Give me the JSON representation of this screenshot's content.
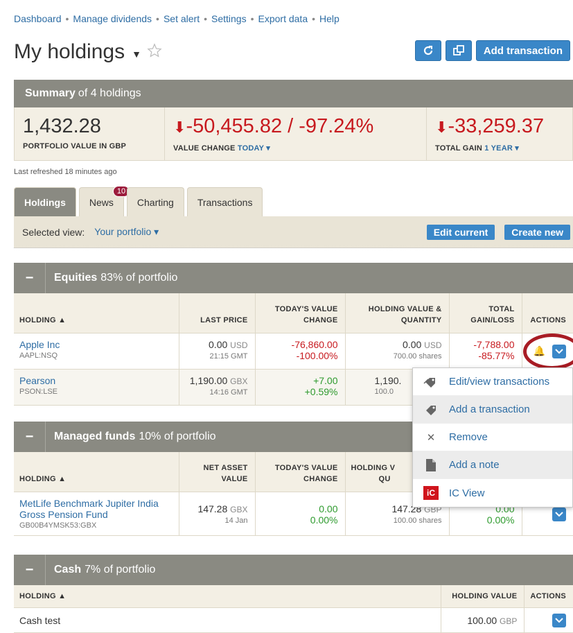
{
  "nav": [
    "Dashboard",
    "Manage dividends",
    "Set alert",
    "Settings",
    "Export data",
    "Help"
  ],
  "title": "My holdings",
  "top_buttons": {
    "add_transaction": "Add transaction"
  },
  "summary": {
    "head_bold": "Summary",
    "head_rest": "of 4 holdings",
    "portfolio_value": "1,432.28",
    "portfolio_label": "PORTFOLIO VALUE IN GBP",
    "value_change": "-50,455.82 / -97.24%",
    "value_change_label": "VALUE CHANGE",
    "value_change_period": "TODAY",
    "total_gain": "-33,259.37",
    "total_gain_label": "TOTAL GAIN",
    "total_gain_period": "1 YEAR"
  },
  "refreshed": "Last refreshed 18 minutes ago",
  "tabs": {
    "holdings": "Holdings",
    "news": "News",
    "news_badge": "10",
    "charting": "Charting",
    "transactions": "Transactions"
  },
  "viewbar": {
    "label": "Selected view:",
    "value": "Your portfolio",
    "edit": "Edit current",
    "create": "Create new"
  },
  "equities": {
    "name": "Equities",
    "pct": "83% of portfolio",
    "headers": [
      "HOLDING ▲",
      "LAST PRICE",
      "TODAY'S VALUE CHANGE",
      "HOLDING VALUE & QUANTITY",
      "TOTAL GAIN/LOSS",
      "ACTIONS"
    ],
    "rows": [
      {
        "name": "Apple Inc",
        "ticker": "AAPL:NSQ",
        "price": "0.00",
        "price_cur": "USD",
        "price_time": "21:15 GMT",
        "chg": "-76,860.00",
        "chg_pct": "-100.00%",
        "val": "0.00",
        "val_cur": "USD",
        "qty": "700.00 shares",
        "gain": "-7,788.00",
        "gain_pct": "-85.77%"
      },
      {
        "name": "Pearson",
        "ticker": "PSON:LSE",
        "price": "1,190.00",
        "price_cur": "GBX",
        "price_time": "14:16 GMT",
        "chg": "+7.00",
        "chg_pct": "+0.59%",
        "val": "1,190.",
        "qty": "100.0"
      }
    ]
  },
  "funds": {
    "name": "Managed funds",
    "pct": "10% of portfolio",
    "headers": [
      "HOLDING ▲",
      "NET ASSET VALUE",
      "TODAY'S VALUE CHANGE",
      "HOLDING V",
      "QU"
    ],
    "rows": [
      {
        "name": "MetLife Benchmark Jupiter India Gross Pension Fund",
        "ticker": "GB00B4YMSK53:GBX",
        "nav": "147.28",
        "nav_cur": "GBX",
        "nav_date": "14 Jan",
        "chg": "0.00",
        "chg_pct": "0.00%",
        "val": "147.28",
        "val_cur": "GBP",
        "qty": "100.00 shares",
        "gain": "0.00",
        "gain_pct": "0.00%"
      }
    ]
  },
  "cash": {
    "name": "Cash",
    "pct": "7% of portfolio",
    "headers": [
      "HOLDING ▲",
      "HOLDING VALUE",
      "ACTIONS"
    ],
    "rows": [
      {
        "name": "Cash test",
        "val": "100.00",
        "val_cur": "GBP"
      }
    ]
  },
  "menu": [
    "Edit/view transactions",
    "Add a transaction",
    "Remove",
    "Add a note",
    "IC View"
  ],
  "menu_ic": "iC"
}
